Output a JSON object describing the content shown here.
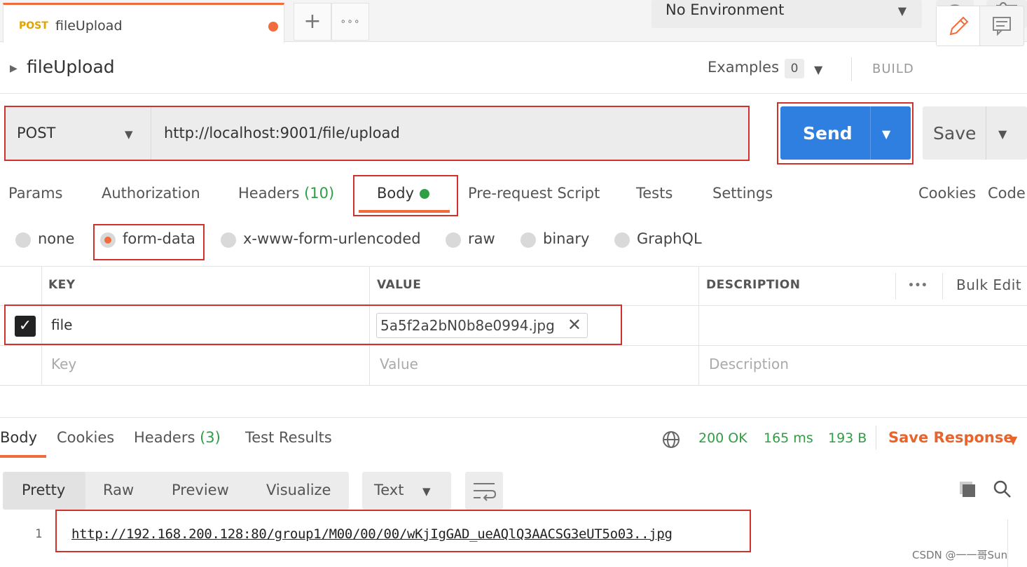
{
  "tabs": {
    "active": {
      "method": "POST",
      "name": "fileUpload"
    },
    "add_label": "+",
    "more_label": "∘∘∘"
  },
  "environment": {
    "selected": "No Environment"
  },
  "request": {
    "title": "fileUpload",
    "examples_label": "Examples",
    "examples_count": "0",
    "build_label": "BUILD",
    "method": "POST",
    "url": "http://localhost:9001/file/upload",
    "send_label": "Send",
    "save_label": "Save"
  },
  "request_tabs": {
    "params": "Params",
    "authorization": "Authorization",
    "headers": "Headers",
    "headers_count": "(10)",
    "body": "Body",
    "pre_request": "Pre-request Script",
    "tests": "Tests",
    "settings": "Settings",
    "cookies": "Cookies",
    "code": "Code"
  },
  "body_types": {
    "none": "none",
    "form_data": "form-data",
    "urlencoded": "x-www-form-urlencoded",
    "raw": "raw",
    "binary": "binary",
    "graphql": "GraphQL",
    "selected": "form-data"
  },
  "table": {
    "headers": {
      "key": "KEY",
      "value": "VALUE",
      "description": "DESCRIPTION",
      "more": "•••",
      "bulk_edit": "Bulk Edit"
    },
    "rows": [
      {
        "checked": true,
        "key": "file",
        "value": "5a5f2a2bN0b8e0994.jpg",
        "description": ""
      }
    ],
    "placeholders": {
      "key": "Key",
      "value": "Value",
      "description": "Description"
    }
  },
  "response": {
    "tabs": {
      "body": "Body",
      "cookies": "Cookies",
      "headers": "Headers",
      "headers_count": "(3)",
      "test_results": "Test Results"
    },
    "status": "200 OK",
    "time": "165 ms",
    "size": "193 B",
    "save_response": "Save Response",
    "formats": {
      "pretty": "Pretty",
      "raw": "Raw",
      "preview": "Preview",
      "visualize": "Visualize"
    },
    "content_type": "Text",
    "lines": [
      {
        "number": "1",
        "text": "http://192.168.200.128:80/group1/M00/00/00/wKjIgGAD_ueAQlQ3AACSG3eUT5o03..jpg"
      }
    ]
  },
  "watermark": "CSDN @一一哥Sun",
  "colors": {
    "accent": "#f26b3a",
    "send": "#2e7fe0",
    "success": "#2f9e44",
    "highlight": "#d0312d"
  },
  "icons": [
    "eye-icon",
    "sliders-icon",
    "pencil-icon",
    "comment-icon",
    "globe-icon",
    "copy-icon",
    "search-icon",
    "wrap-icon",
    "check-icon",
    "close-icon"
  ]
}
